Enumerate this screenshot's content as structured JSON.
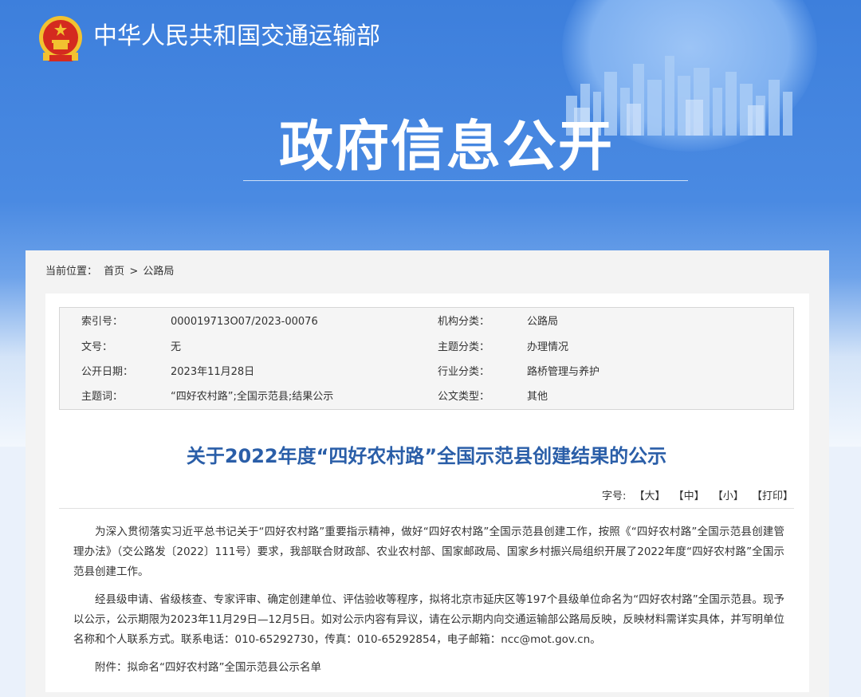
{
  "header": {
    "site_title": "中华人民共和国交通运输部",
    "section_title": "政府信息公开"
  },
  "breadcrumb": {
    "label": "当前位置：",
    "home": "首页",
    "separator": ">",
    "current": "公路局"
  },
  "meta": {
    "rows": [
      {
        "k1": "索引号：",
        "v1": "000019713O07/2023-00076",
        "k2": "机构分类：",
        "v2": "公路局"
      },
      {
        "k1": "文号：",
        "v1": "无",
        "k2": "主题分类：",
        "v2": "办理情况"
      },
      {
        "k1": "公开日期：",
        "v1": "2023年11月28日",
        "k2": "行业分类：",
        "v2": "路桥管理与养护"
      },
      {
        "k1": "主题词：",
        "v1": "“四好农村路”;全国示范县;结果公示",
        "k2": "公文类型：",
        "v2": "其他"
      }
    ]
  },
  "document": {
    "title": "关于2022年度“四好农村路”全国示范县创建结果的公示",
    "fontsize_label": "字号:",
    "fontsize_large": "【大】",
    "fontsize_medium": "【中】",
    "fontsize_small": "【小】",
    "print": "【打印】",
    "paragraphs": [
      "为深入贯彻落实习近平总书记关于“四好农村路”重要指示精神，做好“四好农村路”全国示范县创建工作，按照《“四好农村路”全国示范县创建管理办法》（交公路发〔2022〕111号）要求，我部联合财政部、农业农村部、国家邮政局、国家乡村振兴局组织开展了2022年度“四好农村路”全国示范县创建工作。",
      "经县级申请、省级核查、专家评审、确定创建单位、评估验收等程序，拟将北京市延庆区等197个县级单位命名为“四好农村路”全国示范县。现予以公示，公示期限为2023年11月29日—12月5日。如对公示内容有异议，请在公示期内向交通运输部公路局反映，反映材料需详实具体，并写明单位名称和个人联系方式。联系电话：010-65292730，传真：010-65292854，电子邮箱：ncc@mot.gov.cn。",
      "附件：拟命名“四好农村路”全国示范县公示名单"
    ]
  },
  "colors": {
    "banner_blue": "#3d7fdc",
    "title_blue": "#2a5ea8",
    "emblem_red": "#d42a1f",
    "emblem_gold": "#f2c230"
  }
}
